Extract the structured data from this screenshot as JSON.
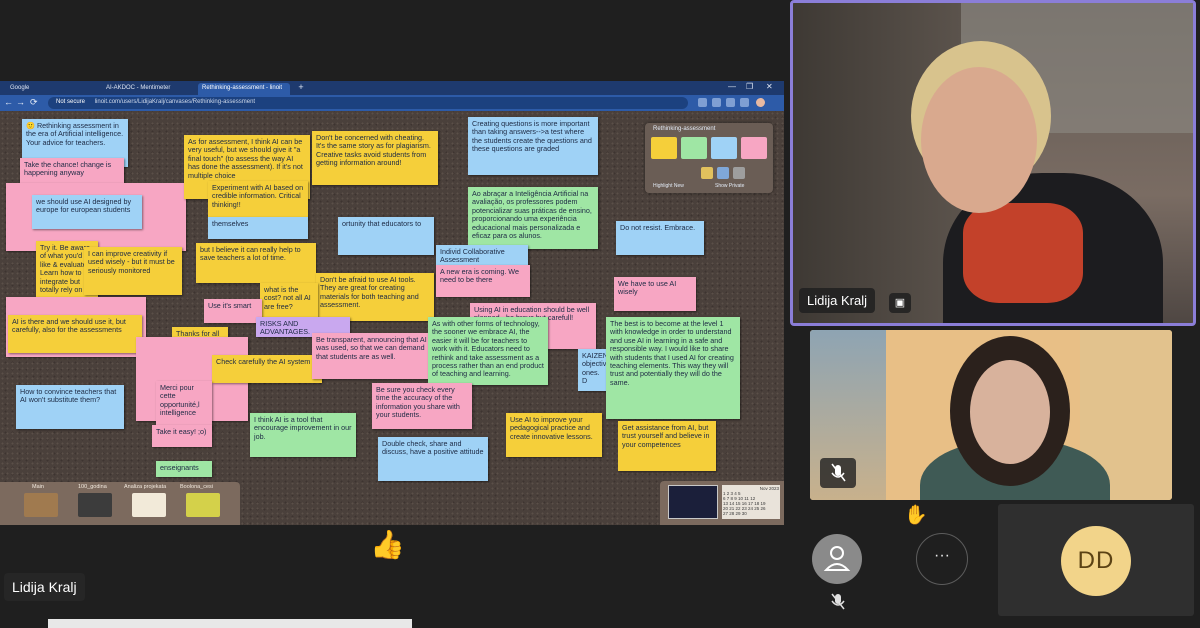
{
  "browser": {
    "tabs": [
      {
        "label": "Google",
        "active": false
      },
      {
        "label": "AI-AKDOC - Mentimeter",
        "active": false
      },
      {
        "label": "Rethinking-assessment - linoit",
        "active": true
      }
    ],
    "new_tab": "+",
    "window_controls": [
      "—",
      "❐",
      "✕"
    ],
    "nav": {
      "back": "←",
      "forward": "→",
      "reload": "⟳"
    },
    "url_security": "Not secure",
    "url": "linoit.com/users/LidijaKralj/canvases/Rethinking-assessment"
  },
  "notes": [
    {
      "id": "n1",
      "color": "blue",
      "text": "🙂 Rethinking assessment in the era of Artificial intelligence. Your advice for teachers."
    },
    {
      "id": "n2",
      "color": "pink",
      "text": "Take the chance! change is happening anyway"
    },
    {
      "id": "n3",
      "color": "blue",
      "text": "we should use AI designed by europe for european students"
    },
    {
      "id": "n4",
      "color": "yellow",
      "text": "Try it. Be aware of what you'd like & evaluate. Learn how to integrate but totally rely on"
    },
    {
      "id": "n5",
      "color": "yellow",
      "text": "I can improve creativity if used wisely - but it must be seriously monitored"
    },
    {
      "id": "n6",
      "color": "yellow",
      "text": "As for assessment, I think AI can be very useful, but we should give it \"a final touch\" (to assess the way AI has done the assessment). If it's not multiple choice"
    },
    {
      "id": "n7",
      "color": "yellow",
      "text": "Experiment with AI based on credible information. Critical thinking!!"
    },
    {
      "id": "n8",
      "color": "yellow",
      "text": "Don't be concerned with cheating. It's the same story as for plagiarism. Creative tasks avoid students from getting information around!"
    },
    {
      "id": "n9",
      "color": "blue",
      "text": "Creating questions is more important than taking answers-->a test where the students create the questions and these questions are graded"
    },
    {
      "id": "n10",
      "color": "green",
      "text": "Ao abraçar a Inteligência Artificial na avaliação, os professores podem potencializar suas práticas de ensino, proporcionando uma experiência educacional mais personalizada e eficaz para os alunos."
    },
    {
      "id": "n11",
      "color": "blue",
      "text": "Do not resist. Embrace."
    },
    {
      "id": "n12",
      "color": "pink",
      "text": "We have to use AI wisely"
    },
    {
      "id": "n13",
      "color": "yellow",
      "text": "Don't be afraid to use AI tools. They are great for creating materials for both teaching and assessment."
    },
    {
      "id": "n14",
      "color": "pink",
      "text": "A new era is coming. We need to be there"
    },
    {
      "id": "n15",
      "color": "yellow",
      "text": "what is the cost? not all AI are free?"
    },
    {
      "id": "n16",
      "color": "pink",
      "text": "Using AI in education should be well planned - be brave but carefull!"
    },
    {
      "id": "n17",
      "color": "yellow",
      "text": "AI is there and we should use it, but carefully, also for the assessments"
    },
    {
      "id": "n18",
      "color": "yellow",
      "text": "Thanks for all"
    },
    {
      "id": "n19",
      "color": "yellow",
      "text": "Check carefully the AI system"
    },
    {
      "id": "n20",
      "color": "pink",
      "text": "Be transparent, announcing that AI was used, so that we can demand that students are as well."
    },
    {
      "id": "n21",
      "color": "green",
      "text": "As with other forms of technology, the sooner we embrace AI, the easier it will be for teachers to work with it. Educators need to rethink and take assessment as a process rather than an end product of teaching and learning."
    },
    {
      "id": "n22",
      "color": "green",
      "text": "The best is to become at the level 1 with knowledge in order to understand and use AI in learning in a safe and responsible way. I would like to share with students that I used AI for creating teaching elements. This way they will trust and potentially they will do the same."
    },
    {
      "id": "n23",
      "color": "blue",
      "text": "How to convince teachers that AI won't substitute them?"
    },
    {
      "id": "n24",
      "color": "pink",
      "text": "Merci pour cette opportunité,l intelligence"
    },
    {
      "id": "n25",
      "color": "pink",
      "text": "Take it easy! ;o)"
    },
    {
      "id": "n26",
      "color": "green",
      "text": "I think AI is a tool that encourage improvement in our job."
    },
    {
      "id": "n27",
      "color": "pink",
      "text": "Be sure you check every time the accuracy of the information you share with your students."
    },
    {
      "id": "n28",
      "color": "yellow",
      "text": "Use AI to improve your pedagogical practice and create innovative lessons."
    },
    {
      "id": "n29",
      "color": "blue",
      "text": "Double check, share and discuss, have a positive attitude"
    },
    {
      "id": "n30",
      "color": "yellow",
      "text": "Get assistance from AI, but trust yourself and believe in your competences"
    },
    {
      "id": "n31",
      "color": "yellow",
      "text": "but I believe it can really help to save teachers a lot of time."
    },
    {
      "id": "n32",
      "color": "blue",
      "text": "KAIZEN objectives ones. D"
    },
    {
      "id": "n33",
      "color": "green",
      "text": "enseignants"
    },
    {
      "id": "n34",
      "color": "pink",
      "text": "Use it's smart"
    },
    {
      "id": "n35",
      "color": "purple",
      "text": "RISKS AND ADVANTAGES."
    },
    {
      "id": "n36",
      "color": "blue",
      "text": "themselves"
    },
    {
      "id": "n37",
      "color": "blue",
      "text": "Individ Collaborative Assessment"
    },
    {
      "id": "n38",
      "color": "blue",
      "text": "ortunity that educators to"
    }
  ],
  "palette": {
    "title": "Rethinking-assessment",
    "left_label": "Highlight New",
    "right_label": "Show Private"
  },
  "shelf": {
    "canvases": [
      "Main",
      "100_godina",
      "Analiza projekata",
      "Boolona_cesi"
    ]
  },
  "minimap": {
    "calendar_header": "Nov 2023",
    "calendar_rows": [
      "1 2 3 4 5",
      "6 7 8 9 10 11 12",
      "13 14 15 16 17 18 19",
      "20 21 22 23 24 25 26",
      "27 28 29 30"
    ]
  },
  "participants": {
    "main_speaker": "Lidija Kralj",
    "presenter_chip": "Lidija Kralj",
    "dd_initials": "DD",
    "more_label": "···",
    "hand_icon": "✋",
    "reaction": "👍"
  }
}
